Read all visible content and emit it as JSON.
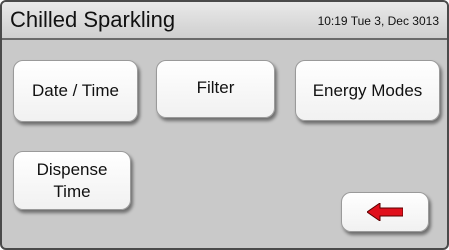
{
  "header": {
    "title": "Chilled Sparkling",
    "clock": "10:19 Tue 3, Dec 3013"
  },
  "buttons": {
    "date_time": "Date / Time",
    "filter": "Filter",
    "energy_modes": "Energy Modes",
    "dispense_line1": "Dispense",
    "dispense_line2": "Time"
  },
  "icons": {
    "back": "left-arrow-icon",
    "back_color": "#e0101c"
  }
}
